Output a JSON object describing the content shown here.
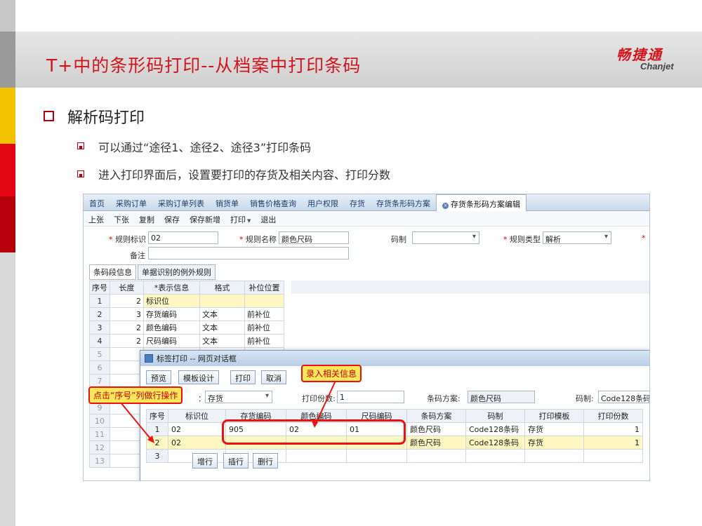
{
  "slide": {
    "title": "T+中的条形码打印--从档案中打印条码",
    "logo_cn": "畅捷通",
    "logo_en": "Chanjet",
    "heading": "解析码打印",
    "bullets": [
      "可以通过“途径1、途径2、途径3”打印条码",
      "进入打印界面后，设置要打印的存货及相关内容、打印分数"
    ]
  },
  "app": {
    "tabs": [
      "首页",
      "采购订单",
      "采购订单列表",
      "销货单",
      "销售价格查询",
      "用户权限",
      "存货",
      "存货条形码方案",
      "存货条形码方案编辑"
    ],
    "toolbar": [
      "上张",
      "下张",
      "复制",
      "保存",
      "保存新增",
      "打印",
      "退出"
    ],
    "form": {
      "rule_code_label": "规则标识",
      "rule_code_value": "02",
      "rule_name_label": "规则名称",
      "rule_name_value": "颜色尺码",
      "code_type_label": "码制",
      "code_type_value": "",
      "rule_type_label": "规则类型",
      "rule_type_value": "解析",
      "remark_label": "备注",
      "remark_value": "",
      "cut_label": "*"
    },
    "subtabs": [
      "条码段信息",
      "单据识别的例外规则"
    ],
    "segment_grid": {
      "headers": [
        "序号",
        "长度",
        "*表示信息",
        "格式",
        "补位位置"
      ],
      "rows": [
        [
          "1",
          "2",
          "标识位",
          "",
          ""
        ],
        [
          "2",
          "3",
          "存货编码",
          "文本",
          "前补位"
        ],
        [
          "3",
          "2",
          "颜色编码",
          "文本",
          "前补位"
        ],
        [
          "4",
          "2",
          "尺码编码",
          "文本",
          "前补位"
        ]
      ],
      "empty_rows": [
        "5",
        "6",
        "7",
        "8",
        "9",
        "10",
        "11",
        "12",
        "13"
      ]
    }
  },
  "dialog": {
    "title": "标签打印 -- 网页对话框",
    "buttons": [
      "预览",
      "模板设计",
      "打印",
      "取消"
    ],
    "filter_hint": "：",
    "filter_value": "存货",
    "print_count_label": "打印份数:",
    "print_count_value": "1",
    "scheme_label": "条码方案:",
    "scheme_value": "颜色尺码",
    "code_label": "码制:",
    "code_value": "Code128条码",
    "headers": [
      "序号",
      "标识位",
      "存货编码",
      "颜色编码",
      "尺码编码",
      "条码方案",
      "码制",
      "打印模板",
      "打印份数"
    ],
    "rows": [
      [
        "1",
        "02",
        "905",
        "02",
        "01",
        "颜色尺码",
        "Code128条码",
        "存货",
        "1"
      ],
      [
        "2",
        "02",
        "",
        "",
        "",
        "颜色尺码",
        "Code128条码",
        "存货",
        "1"
      ],
      [
        "3",
        "",
        "",
        "",
        "",
        "",
        "",
        "",
        ""
      ]
    ],
    "row_buttons": [
      "增行",
      "插行",
      "删行"
    ]
  },
  "annotations": {
    "callout_input": "录入相关信息",
    "callout_row": "点击“序号”列做行操作"
  },
  "colors": {
    "accent_red": "#d4141c",
    "callout_fill": "#fbe85a",
    "highlight_row": "#fff7c2"
  }
}
